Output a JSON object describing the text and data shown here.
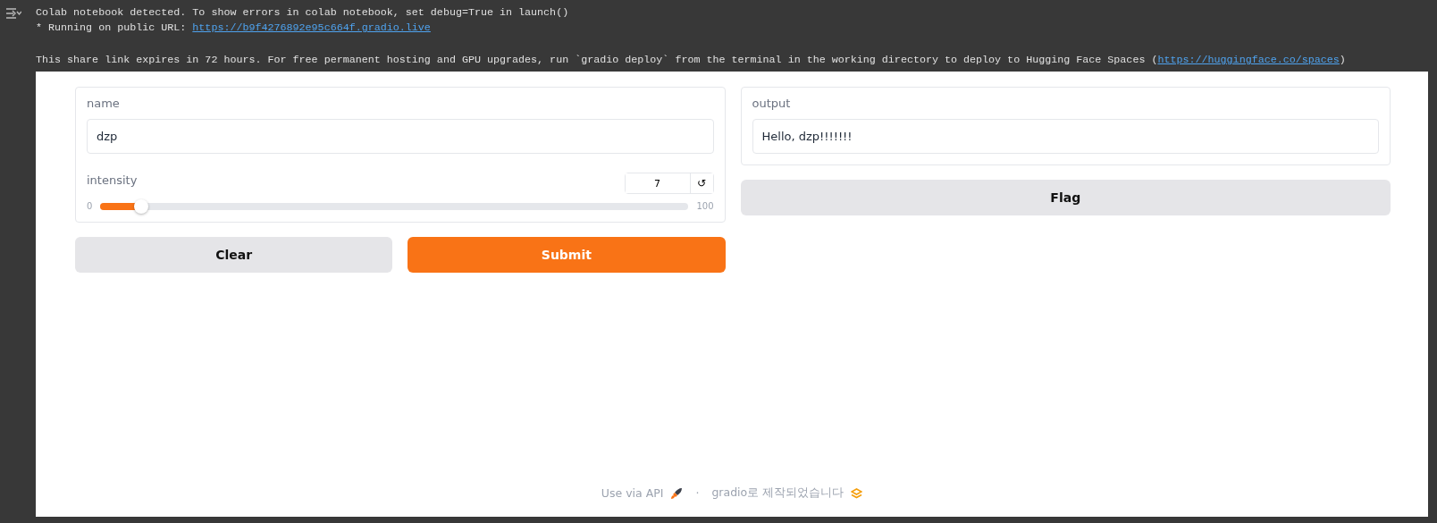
{
  "console": {
    "blocks": [
      [
        {
          "parts": [
            {
              "kind": "text",
              "text": "Colab notebook detected. To show errors in colab notebook, set debug=True in launch()"
            }
          ]
        },
        {
          "parts": [
            {
              "kind": "text",
              "text": "* Running on public URL: "
            },
            {
              "kind": "link",
              "text": "https://b9f4276892e95c664f.gradio.live"
            }
          ]
        }
      ],
      [
        {
          "parts": [
            {
              "kind": "text",
              "text": "This share link expires in 72 hours. For free permanent hosting and GPU upgrades, run `gradio deploy` from the terminal in the working directory to deploy to Hugging Face Spaces ("
            },
            {
              "kind": "link",
              "text": "https://huggingface.co/spaces"
            },
            {
              "kind": "text",
              "text": ")"
            }
          ]
        }
      ]
    ]
  },
  "inputs": {
    "name": {
      "label": "name",
      "value": "dzp"
    },
    "intensity": {
      "label": "intensity",
      "value": "7",
      "reset": "↺",
      "min": "0",
      "max": "100",
      "level": 0.07
    }
  },
  "input_buttons": [
    {
      "label": "Clear",
      "kind": "secondary"
    },
    {
      "label": "Submit",
      "kind": "primary"
    }
  ],
  "output": {
    "label": "output",
    "value": "Hello, dzp!!!!!!!"
  },
  "output_buttons": [
    {
      "label": "Flag",
      "kind": "secondary"
    }
  ],
  "footer": {
    "api": "Use via API",
    "separator": "·",
    "built_with": "gradio로 제작되었습니다"
  }
}
